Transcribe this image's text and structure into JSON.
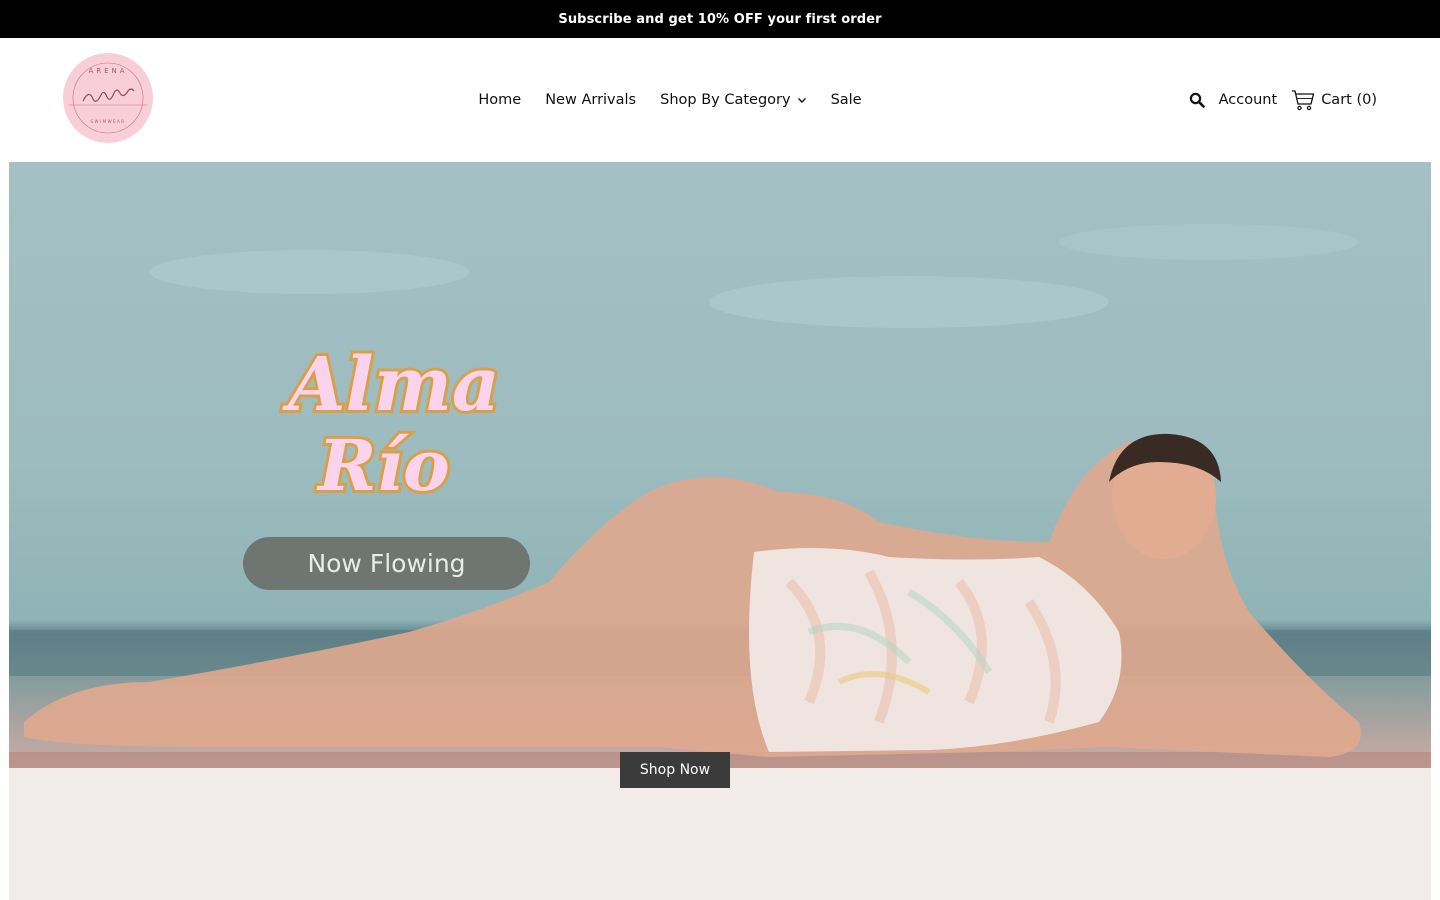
{
  "announcement": {
    "text": "Subscribe and get 10% OFF your first order"
  },
  "brand": {
    "logo_text": "ARENA cristal SWIMWEAR",
    "logo_bg": "#f8cfd8"
  },
  "nav": {
    "items": [
      {
        "label": "Home"
      },
      {
        "label": "New Arrivals"
      },
      {
        "label": "Shop By Category",
        "has_dropdown": true
      },
      {
        "label": "Sale"
      }
    ]
  },
  "header_actions": {
    "search_icon": "search-icon",
    "account_label": "Account",
    "cart_label": "Cart (0)",
    "cart_icon": "cart-icon"
  },
  "hero": {
    "title_line1": "Alma",
    "title_line2": "Río",
    "pill_label": "Now Flowing",
    "cta_label": "Shop Now",
    "title_fill": "#fcd3ec",
    "title_outline": "#d7a14c",
    "pill_color": "#6f7570",
    "cta_color": "#3b3b3b"
  }
}
